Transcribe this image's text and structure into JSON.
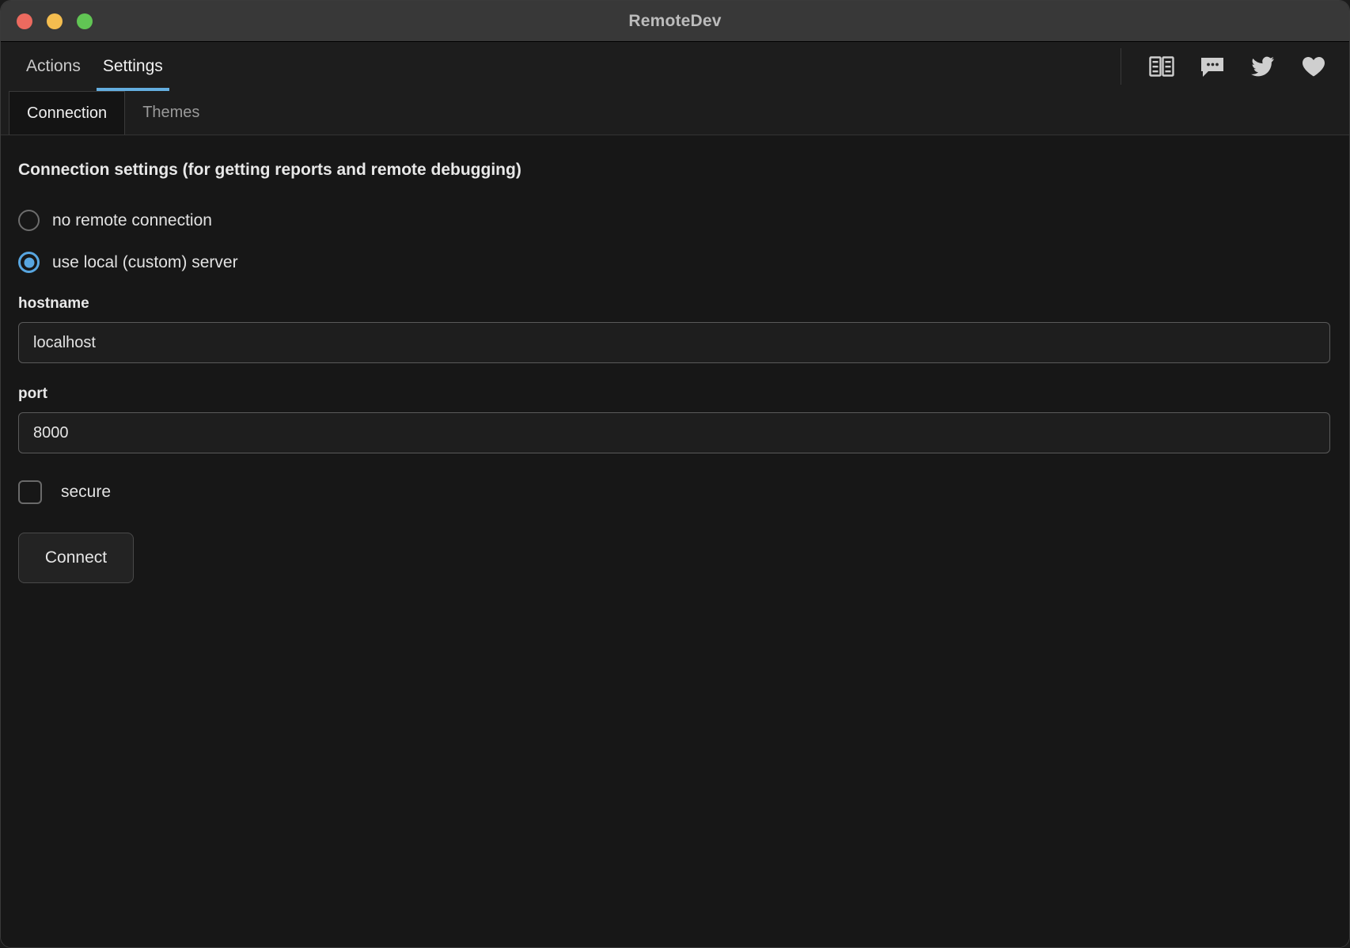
{
  "window": {
    "title": "RemoteDev",
    "traffic_lights": [
      {
        "name": "close",
        "color": "#ec6a5f"
      },
      {
        "name": "minimize",
        "color": "#f4bd4f"
      },
      {
        "name": "maximize",
        "color": "#61c554"
      }
    ]
  },
  "main_tabs": [
    {
      "label": "Actions",
      "active": false
    },
    {
      "label": "Settings",
      "active": true
    }
  ],
  "top_icons": [
    {
      "name": "book-icon",
      "title": "Docs"
    },
    {
      "name": "chat-bubble-icon",
      "title": "Chat"
    },
    {
      "name": "twitter-icon",
      "title": "Twitter"
    },
    {
      "name": "heart-icon",
      "title": "Support"
    }
  ],
  "sub_tabs": [
    {
      "label": "Connection",
      "active": true
    },
    {
      "label": "Themes",
      "active": false
    }
  ],
  "settings": {
    "heading": "Connection settings (for getting reports and remote debugging)",
    "radios": [
      {
        "label": "no remote connection",
        "checked": false
      },
      {
        "label": "use local (custom) server",
        "checked": true
      }
    ],
    "hostname": {
      "label": "hostname",
      "value": "localhost",
      "placeholder": "localhost"
    },
    "port": {
      "label": "port",
      "value": "8000",
      "placeholder": "8000"
    },
    "secure": {
      "label": "secure",
      "checked": false
    },
    "connect_label": "Connect"
  },
  "colors": {
    "accent": "#58a6e0",
    "tab_underline": "#64aee0",
    "titlebar": "#383838",
    "background": "#171717"
  }
}
